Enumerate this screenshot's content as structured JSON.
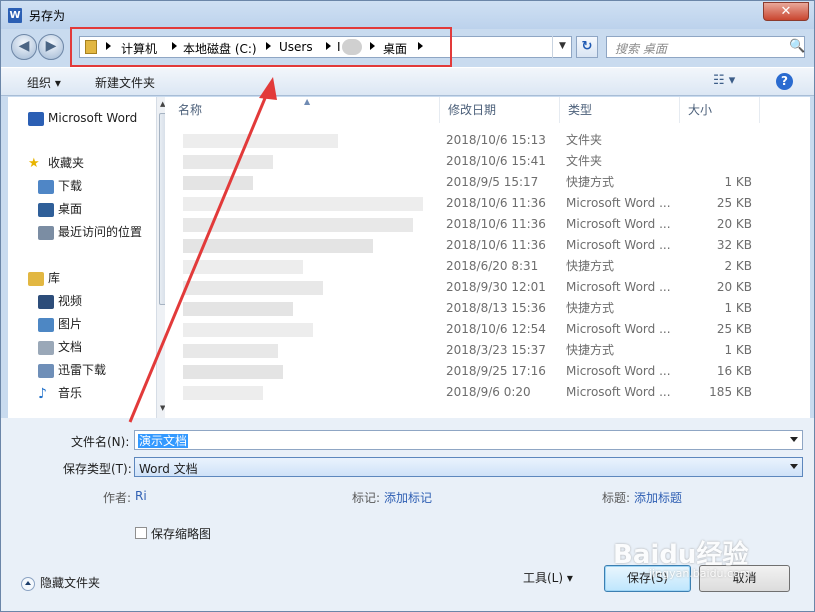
{
  "window": {
    "title": "另存为",
    "app_icon_letter": "W",
    "close_glyph": "✕"
  },
  "nav": {
    "back_glyph": "◀",
    "forward_glyph": "▶",
    "refresh_glyph": "↻"
  },
  "address": {
    "crumbs": [
      "计算机",
      "本地磁盘 (C:)",
      "Users",
      "I",
      "桌面"
    ],
    "dropdown_glyph": "▼"
  },
  "search": {
    "placeholder": "搜索 桌面",
    "icon_glyph": "🔍"
  },
  "toolbar": {
    "organize_label": "组织 ▾",
    "new_folder_label": "新建文件夹",
    "view_glyph": "☷ ▾",
    "help_glyph": "?"
  },
  "sidebar": {
    "items": [
      {
        "label": "Microsoft Word",
        "icon": "word-icon",
        "color": "#2b5fb4"
      },
      {
        "label": "收藏夹",
        "icon": "star-icon",
        "color": "#e8b400"
      },
      {
        "label": "下载",
        "icon": "download-icon",
        "color": "#4f86c6"
      },
      {
        "label": "桌面",
        "icon": "desktop-icon",
        "color": "#2f5f99"
      },
      {
        "label": "最近访问的位置",
        "icon": "recent-icon",
        "color": "#7b8da3"
      },
      {
        "label": "库",
        "icon": "library-icon",
        "color": "#e2b742"
      },
      {
        "label": "视频",
        "icon": "video-icon",
        "color": "#2d4d7a"
      },
      {
        "label": "图片",
        "icon": "picture-icon",
        "color": "#4d87c4"
      },
      {
        "label": "文档",
        "icon": "document-icon",
        "color": "#9aa8b8"
      },
      {
        "label": "迅雷下载",
        "icon": "thunder-download-icon",
        "color": "#6f8fb8"
      },
      {
        "label": "音乐",
        "icon": "music-icon",
        "color": "#1f6fc9"
      }
    ]
  },
  "files": {
    "columns": [
      "名称",
      "修改日期",
      "类型",
      "大小"
    ],
    "rows": [
      {
        "date": "2018/10/6 15:13",
        "type": "文件夹",
        "size": ""
      },
      {
        "date": "2018/10/6 15:41",
        "type": "文件夹",
        "size": ""
      },
      {
        "date": "2018/9/5 15:17",
        "type": "快捷方式",
        "size": "1 KB"
      },
      {
        "date": "2018/10/6 11:36",
        "type": "Microsoft Word ...",
        "size": "25 KB"
      },
      {
        "date": "2018/10/6 11:36",
        "type": "Microsoft Word ...",
        "size": "20 KB"
      },
      {
        "date": "2018/10/6 11:36",
        "type": "Microsoft Word ...",
        "size": "32 KB"
      },
      {
        "date": "2018/6/20 8:31",
        "type": "快捷方式",
        "size": "2 KB"
      },
      {
        "date": "2018/9/30 12:01",
        "type": "Microsoft Word ...",
        "size": "20 KB"
      },
      {
        "date": "2018/8/13 15:36",
        "type": "快捷方式",
        "size": "1 KB"
      },
      {
        "date": "2018/10/6 12:54",
        "type": "Microsoft Word ...",
        "size": "25 KB"
      },
      {
        "date": "2018/3/23 15:37",
        "type": "快捷方式",
        "size": "1 KB"
      },
      {
        "date": "2018/9/25 17:16",
        "type": "Microsoft Word ...",
        "size": "16 KB"
      },
      {
        "date": "2018/9/6 0:20",
        "type": "Microsoft Word ...",
        "size": "185 KB"
      }
    ]
  },
  "form": {
    "filename_label": "文件名(N):",
    "filename_value": "演示文档",
    "filetype_label": "保存类型(T):",
    "filetype_value": "Word 文档",
    "author_label": "作者:",
    "author_value": "Ri",
    "tags_label": "标记:",
    "tags_value": "添加标记",
    "title_label": "标题:",
    "title_value": "添加标题",
    "thumbnail_label": "保存缩略图"
  },
  "buttons": {
    "tools": "工具(L) ▾",
    "save": "保存(S)",
    "cancel": "取消",
    "hide_folders": "隐藏文件夹"
  },
  "watermark": {
    "text": "Baidu经验",
    "sub": "jingyan.baidu.com"
  },
  "colors": {
    "annotation_red": "#e23a3a",
    "selection_blue": "#3399ff"
  }
}
